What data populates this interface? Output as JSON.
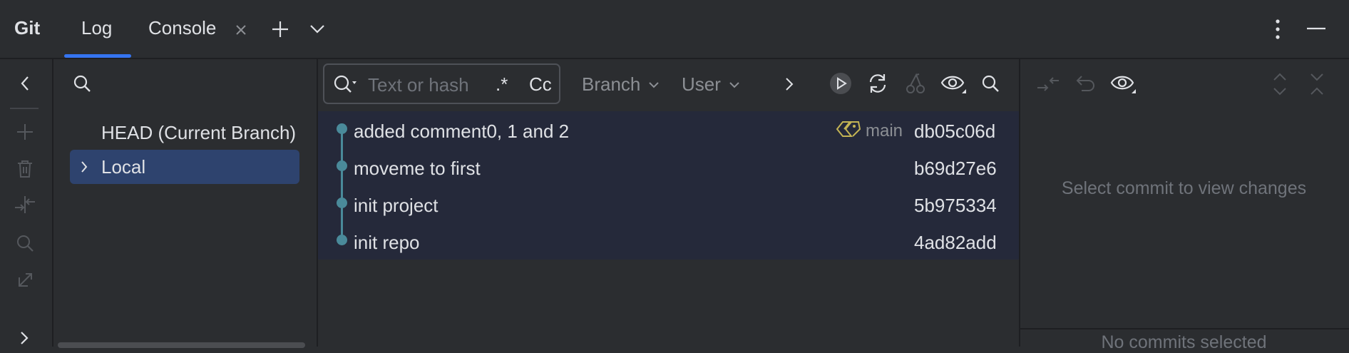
{
  "app": {
    "title": "Git"
  },
  "tabs": [
    {
      "label": "Log",
      "active": true
    },
    {
      "label": "Console",
      "active": false
    }
  ],
  "branches": {
    "head_label": "HEAD (Current Branch)",
    "local_label": "Local"
  },
  "filter": {
    "placeholder": "Text or hash",
    "regex_label": ".*",
    "case_label": "Cc",
    "branch_label": "Branch",
    "user_label": "User"
  },
  "commits": [
    {
      "message": "added comment0, 1 and 2",
      "hash": "db05c06d",
      "ref": "main"
    },
    {
      "message": "moveme to first",
      "hash": "b69d27e6"
    },
    {
      "message": "init project",
      "hash": "5b975334"
    },
    {
      "message": "init repo",
      "hash": "4ad82add"
    }
  ],
  "details": {
    "empty_text": "Select commit to view changes",
    "bottom_text": "No commits selected"
  },
  "colors": {
    "accent": "#3574f0",
    "graph": "#4a8a9a",
    "selection": "#2e436e",
    "tag": "#c4b454"
  }
}
